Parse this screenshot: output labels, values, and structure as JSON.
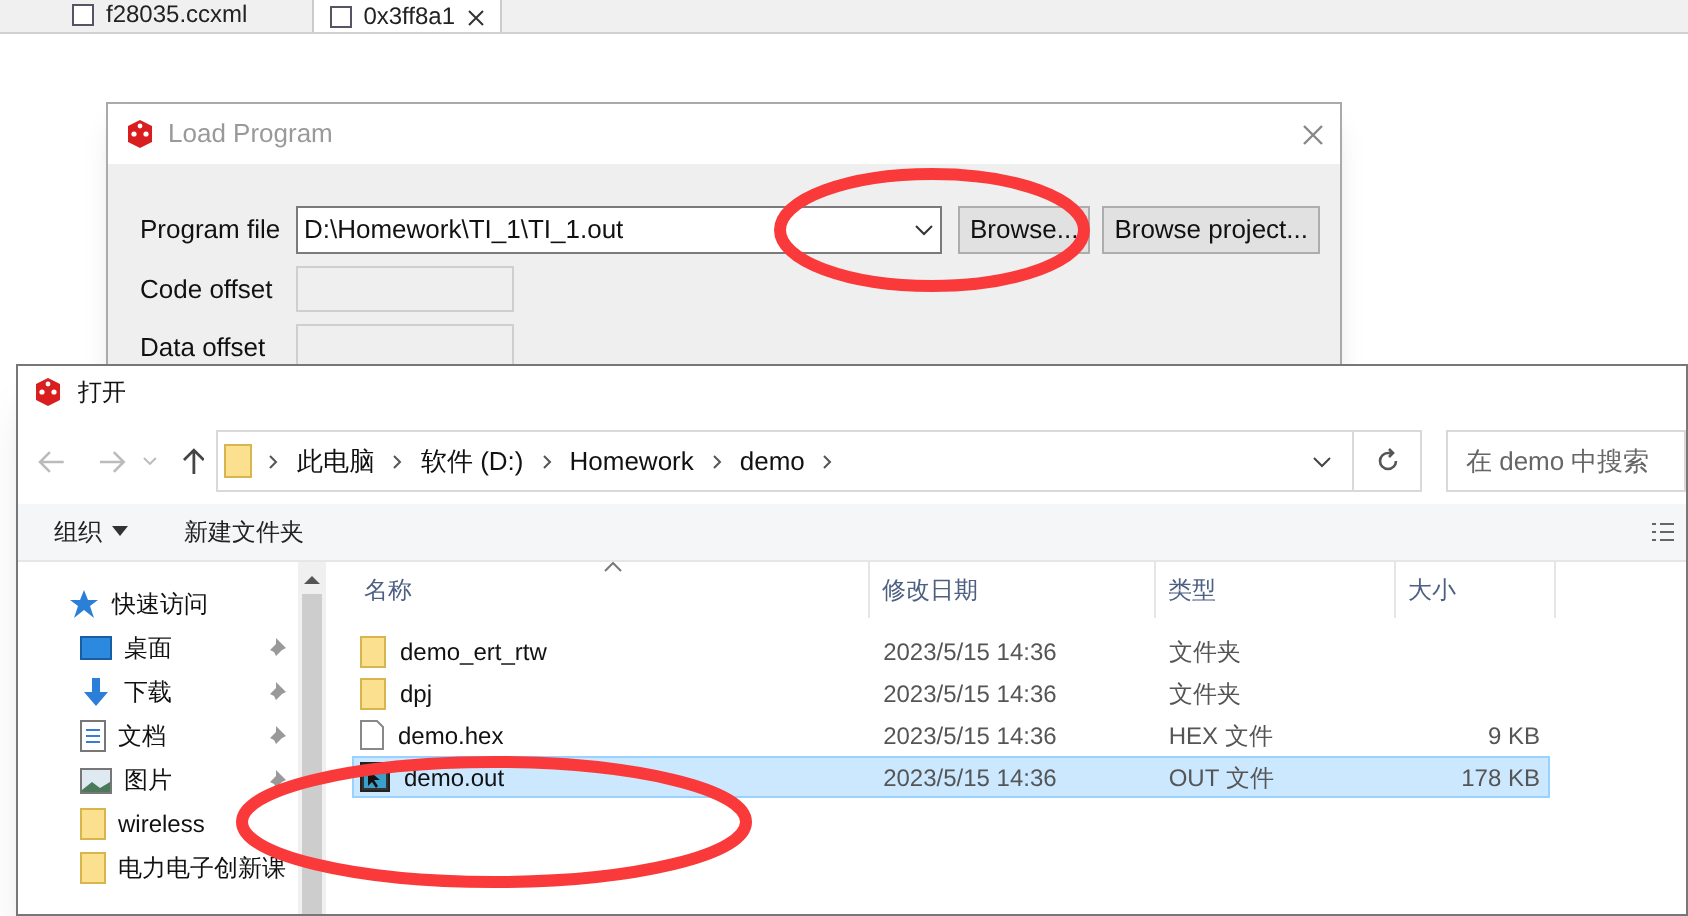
{
  "editor_tabs": [
    {
      "label": "f28035.ccxml",
      "selected": false
    },
    {
      "label": "0x3ff8a1",
      "selected": true
    }
  ],
  "load_program": {
    "title": "Load Program",
    "program_file_label": "Program file",
    "program_file_value": "D:\\Homework\\TI_1\\TI_1.out",
    "code_offset_label": "Code offset",
    "data_offset_label": "Data offset",
    "buttons": [
      "Browse...",
      "Browse project..."
    ]
  },
  "open_dialog": {
    "title": "打开",
    "breadcrumb": [
      "此电脑",
      "软件 (D:)",
      "Homework",
      "demo"
    ],
    "search": {
      "placeholder": "在 demo 中搜索"
    },
    "toolbar": {
      "organize": "组织",
      "new_folder": "新建文件夹"
    },
    "sidebar": {
      "items": [
        {
          "label": "快速访问",
          "kind": "star",
          "pinned": false
        },
        {
          "label": "桌面",
          "kind": "desktop",
          "pinned": true
        },
        {
          "label": "下载",
          "kind": "download",
          "pinned": true
        },
        {
          "label": "文档",
          "kind": "document",
          "pinned": true
        },
        {
          "label": "图片",
          "kind": "picture",
          "pinned": true
        },
        {
          "label": "wireless",
          "kind": "folder",
          "pinned": false
        },
        {
          "label": "电力电子创新课",
          "kind": "folder",
          "pinned": false
        }
      ]
    },
    "table": {
      "columns": [
        "名称",
        "修改日期",
        "类型",
        "大小"
      ],
      "rows": [
        {
          "name": "demo_ert_rtw",
          "modified": "2023/5/15 14:36",
          "type": "文件夹",
          "kind": "folder",
          "selected": false
        },
        {
          "name": "dpj",
          "modified": "2023/5/15 14:36",
          "type": "文件夹",
          "kind": "folder",
          "selected": false
        },
        {
          "name": "demo.hex",
          "modified": "2023/5/15 14:36",
          "type": "HEX 文件",
          "size": "9 KB",
          "kind": "file",
          "selected": false
        },
        {
          "name": "demo.out",
          "modified": "2023/5/15 14:36",
          "type": "OUT 文件",
          "size": "178 KB",
          "kind": "program",
          "selected": true
        }
      ]
    }
  },
  "annotations": [
    {
      "kind": "ellipse"
    },
    {
      "kind": "ellipse"
    }
  ]
}
